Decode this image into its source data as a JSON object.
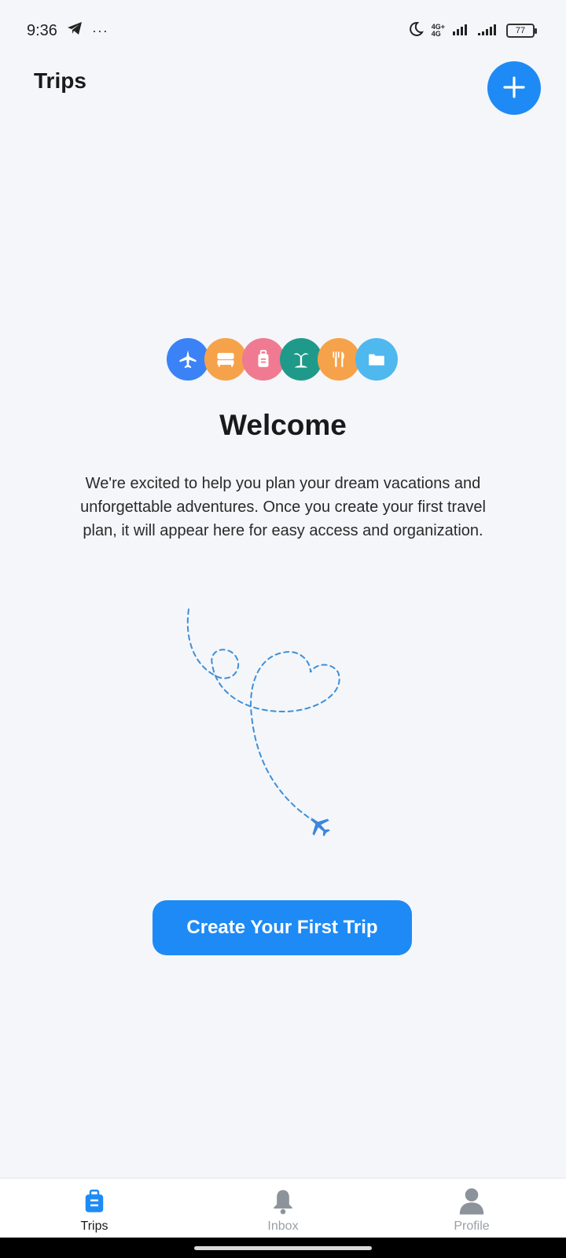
{
  "status_bar": {
    "time": "9:36",
    "dots": "···",
    "network_label_top": "4G+",
    "network_label_bottom": "4G",
    "battery": "77"
  },
  "header": {
    "title": "Trips",
    "add_icon": "plus-icon"
  },
  "welcome": {
    "category_icons": [
      {
        "name": "airplane-icon",
        "color": "#3b82f6"
      },
      {
        "name": "bed-icon",
        "color": "#f6a24a"
      },
      {
        "name": "luggage-icon",
        "color": "#f07a91"
      },
      {
        "name": "island-icon",
        "color": "#1f9a8a"
      },
      {
        "name": "restaurant-icon",
        "color": "#f6a24a"
      },
      {
        "name": "folder-icon",
        "color": "#4fb8ee"
      }
    ],
    "title": "Welcome",
    "text": "We're excited to help you plan your dream vacations and unforgettable adventures. Once you create your first travel plan, it will appear here for easy access and organization."
  },
  "cta": {
    "label": "Create Your First Trip"
  },
  "bottom_nav": {
    "items": [
      {
        "label": "Trips",
        "icon": "suitcase-icon",
        "active": true
      },
      {
        "label": "Inbox",
        "icon": "bell-icon",
        "active": false
      },
      {
        "label": "Profile",
        "icon": "person-icon",
        "active": false
      }
    ]
  },
  "colors": {
    "accent": "#1e8af5",
    "background": "#f4f6fa",
    "nav_inactive": "#9aa0a8"
  }
}
